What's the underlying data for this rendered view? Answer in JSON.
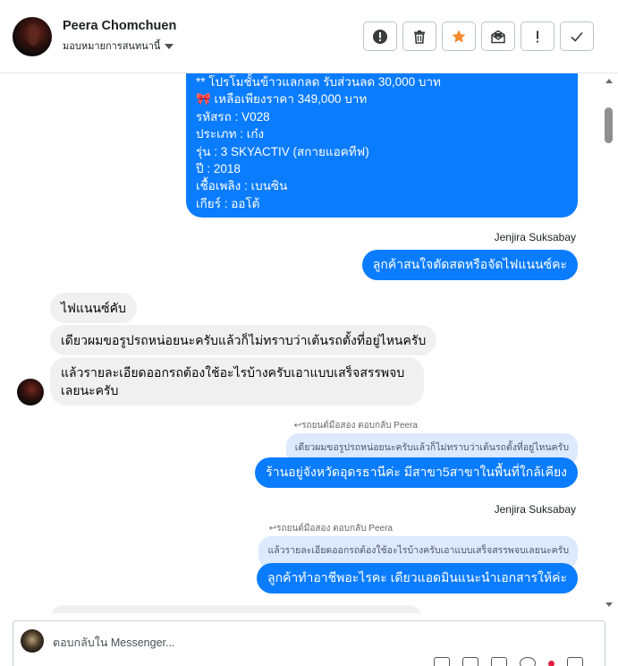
{
  "header": {
    "contact_name": "Peera Chomchuen",
    "assign_label": "มอบหมายการสนทนานี้"
  },
  "toolbar": {
    "spam": "!",
    "mark_unread": "!",
    "star_color": "#f5892b"
  },
  "colors": {
    "outgoing_bubble": "#0a7cff",
    "incoming_bubble": "#f0f0f0",
    "quote_bubble": "#dce9ff"
  },
  "messages": {
    "car_info": [
      "** โปรโมชั้นข้าวแลกลด รับส่วนลด 30,000 บาท",
      "🎀 เหลือเพียงราคา 349,000 บาท",
      "รหัสรถ : V028",
      "ประเภท : เก๋ง",
      "รุ่น : 3 SKYACTIV (สกายแอคทีฟ)",
      "ปี : 2018",
      "เชื้อเพลิง : เบนซิน",
      "เกียร์ : ออโต้"
    ],
    "sender_1": "Jenjira Suksabay",
    "out_1": "ลูกค้าสนใจตัดสดหรือจัดไฟแนนซ์คะ",
    "in_1": "ไฟแนนซ์คับ",
    "in_2": "เดียวผมขอรูปรถหน่อยนะครับแล้วก็ไม่ทราบว่าเต้นรถตั้งที่อยู่ไหนครับ",
    "in_3": "แล้วรายละเอียดออกรถต้องใช้อะไรบ้างครับเอาแบบเสร็จสรรพจบเลยนะครับ",
    "reply_label_1": "รถยนต์มือสอง ตอบกลับ Peera",
    "quote_1": "เดียวผมขอรูปรถหน่อยนะครับแล้วก็ไม่ทราบว่าเต้นรถตั้งที่อยู่ไหนครับ",
    "out_2": "ร้านอยู่จังหวัดอุดรธานีค่ะ มีสาขา5สาขาในพื้นที่ใกล้เคียง",
    "sender_2": "Jenjira Suksabay",
    "reply_label_2": "รถยนต์มือสอง ตอบกลับ Peera",
    "quote_2": "แล้วรายละเอียดออกรถต้องใช้อะไรบ้างครับเอาแบบเสร็จสรรพจบเลยนะครับ",
    "out_3": "ลูกค้าทำอาชีพอะไรคะ เดียวแอดมินแนะนำเอกสารให้ค่ะ"
  },
  "composer": {
    "placeholder": "ตอบกลับใน Messenger..."
  }
}
